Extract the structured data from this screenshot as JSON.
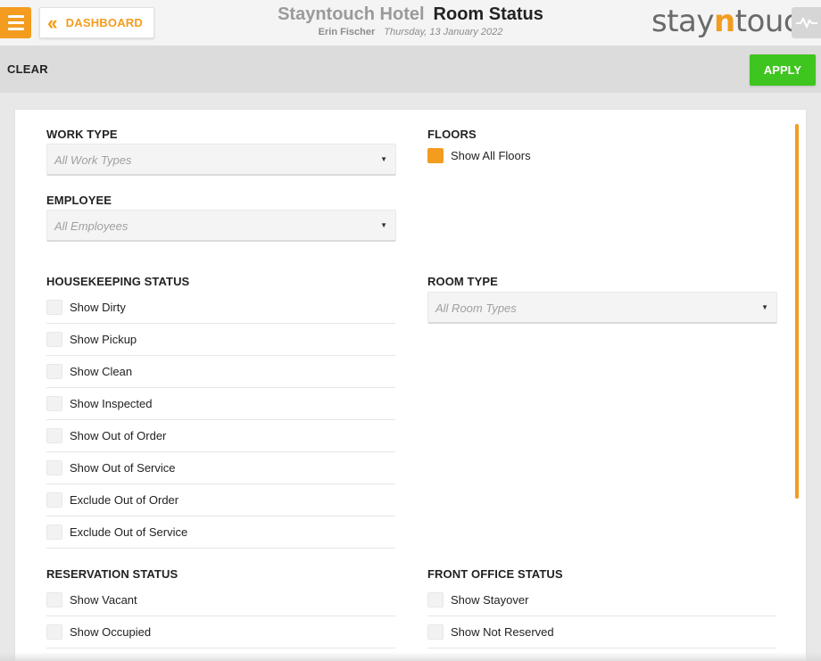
{
  "header": {
    "dashboard_label": "DASHBOARD",
    "hotel_name": "Stayntouch Hotel",
    "page_title": "Room Status",
    "user_name": "Erin Fischer",
    "date": "Thursday, 13 January 2022",
    "logo_pre": "stay",
    "logo_n": "n",
    "logo_post": "touch",
    "menu_icon": "hamburger-icon",
    "back_icon": "double-chevron-left-icon",
    "pulse_icon": "pulse-icon"
  },
  "toolbar": {
    "clear_label": "CLEAR",
    "apply_label": "APPLY"
  },
  "filters": {
    "work_type": {
      "title": "WORK TYPE",
      "placeholder": "All Work Types"
    },
    "employee": {
      "title": "EMPLOYEE",
      "placeholder": "All Employees"
    },
    "floors": {
      "title": "FLOORS",
      "option_label": "Show All Floors"
    },
    "room_type": {
      "title": "ROOM TYPE",
      "placeholder": "All Room Types"
    },
    "housekeeping": {
      "title": "HOUSEKEEPING STATUS",
      "options": [
        "Show Dirty",
        "Show Pickup",
        "Show Clean",
        "Show Inspected",
        "Show Out of Order",
        "Show Out of Service",
        "Exclude Out of Order",
        "Exclude Out of Service"
      ]
    },
    "reservation": {
      "title": "RESERVATION STATUS",
      "options": [
        "Show Vacant",
        "Show Occupied"
      ]
    },
    "front_office": {
      "title": "FRONT OFFICE STATUS",
      "options": [
        "Show Stayover",
        "Show Not Reserved"
      ]
    }
  },
  "colors": {
    "accent": "#f39c1f",
    "apply": "#3fc51f"
  }
}
